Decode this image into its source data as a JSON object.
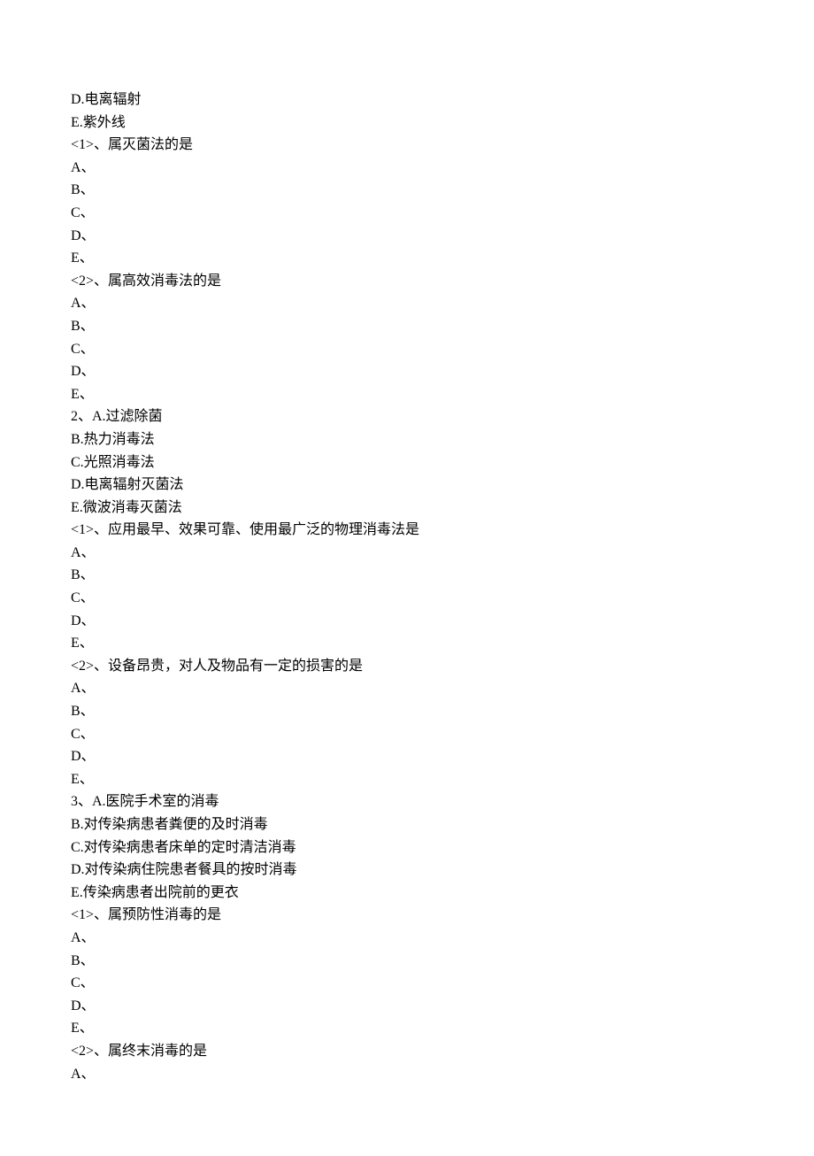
{
  "lines": [
    "D.电离辐射",
    "E.紫外线",
    "<1>、属灭菌法的是",
    "A、",
    "B、",
    "C、",
    "D、",
    "E、",
    "<2>、属高效消毒法的是",
    "A、",
    "B、",
    "C、",
    "D、",
    "E、",
    "2、A.过滤除菌",
    "B.热力消毒法",
    "C.光照消毒法",
    "D.电离辐射灭菌法",
    "E.微波消毒灭菌法",
    "<1>、应用最早、效果可靠、使用最广泛的物理消毒法是",
    "A、",
    "B、",
    "C、",
    "D、",
    "E、",
    "<2>、设备昂贵，对人及物品有一定的损害的是",
    "A、",
    "B、",
    "C、",
    "D、",
    "E、",
    "3、A.医院手术室的消毒",
    "B.对传染病患者粪便的及时消毒",
    "C.对传染病患者床单的定时清洁消毒",
    "D.对传染病住院患者餐具的按时消毒",
    "E.传染病患者出院前的更衣",
    "<1>、属预防性消毒的是",
    "A、",
    "B、",
    "C、",
    "D、",
    "E、",
    "<2>、属终末消毒的是",
    "A、"
  ]
}
